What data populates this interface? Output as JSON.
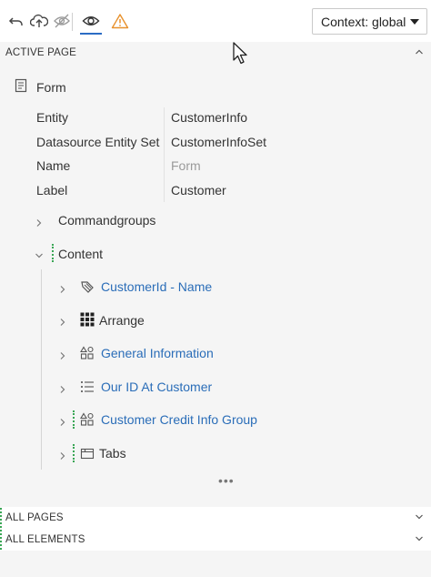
{
  "toolbar": {
    "undo_icon": "undo-icon",
    "upload_icon": "cloud-upload-icon",
    "hide_icon": "eye-off-icon",
    "preview_icon": "eye-icon",
    "warning_icon": "warning-icon",
    "warning_color": "#e8912d",
    "active_accent": "#2b6cc4",
    "context_select": "Context: global"
  },
  "sections": {
    "active_page": "ACTIVE PAGE",
    "all_pages": "ALL PAGES",
    "all_elements": "ALL ELEMENTS"
  },
  "form": {
    "title": "Form",
    "properties": [
      {
        "label": "Entity",
        "value": "CustomerInfo"
      },
      {
        "label": "Datasource Entity Set",
        "value": "CustomerInfoSet"
      },
      {
        "label": "Name",
        "value": "Form"
      },
      {
        "label": "Label",
        "value": "Customer"
      }
    ]
  },
  "tree": {
    "commandgroups": "Commandgroups",
    "content": "Content",
    "children": [
      {
        "label": "CustomerId - Name",
        "icon": "tag-icon",
        "link": true
      },
      {
        "label": "Arrange",
        "icon": "grid-icon",
        "link": false
      },
      {
        "label": "General Information",
        "icon": "shapes-icon",
        "link": true
      },
      {
        "label": "Our ID At Customer",
        "icon": "list-icon",
        "link": true
      },
      {
        "label": "Customer Credit Info Group",
        "icon": "shapes-icon",
        "link": true
      },
      {
        "label": "Tabs",
        "icon": "tabs-icon",
        "link": false
      }
    ],
    "more": "•••"
  },
  "colors": {
    "link": "#2a6db8",
    "marker_green": "#3aa655",
    "panel_bg": "#f5f5f5"
  }
}
